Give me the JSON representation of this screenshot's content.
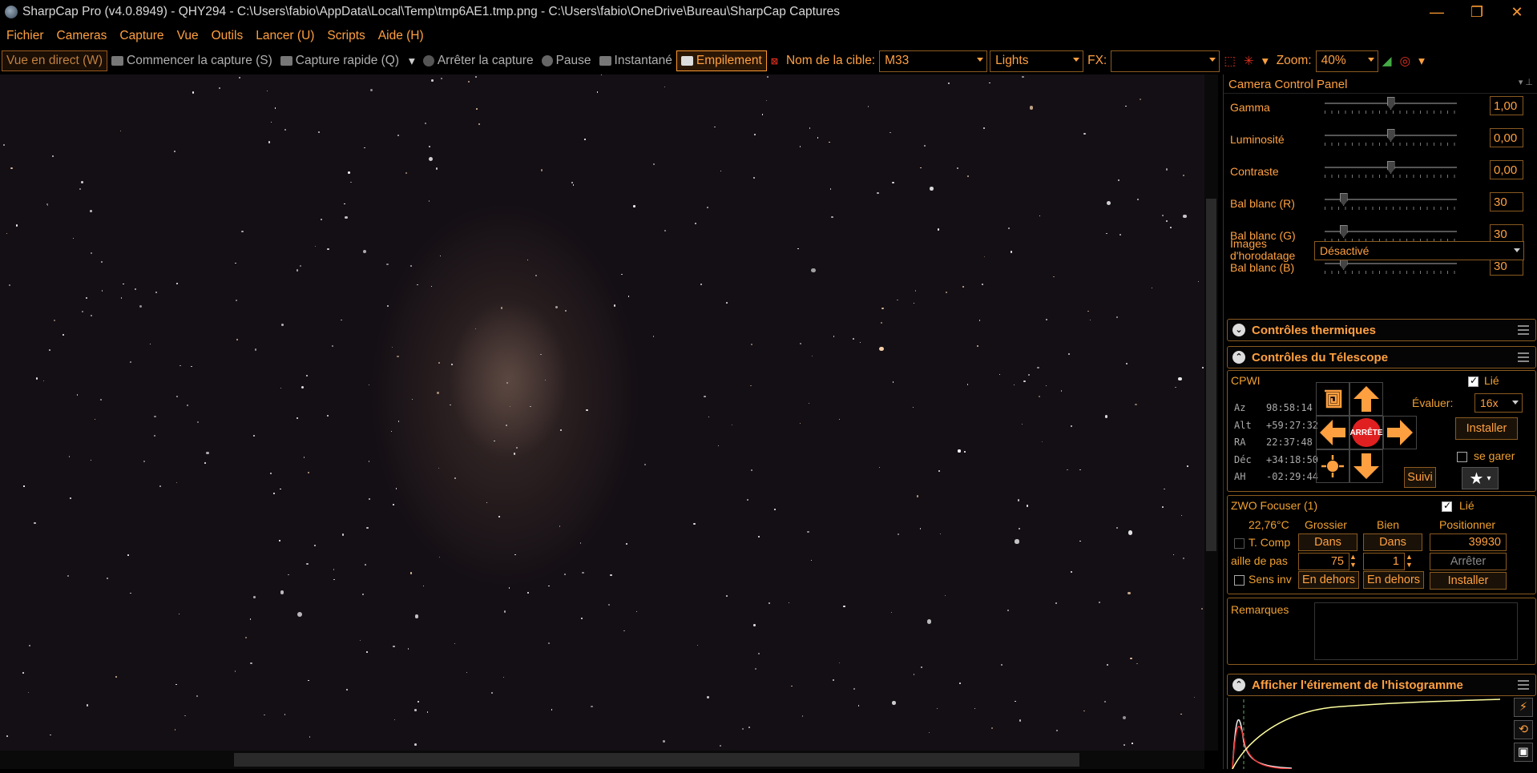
{
  "window": {
    "title": "SharpCap Pro (v4.0.8949) - QHY294 - C:\\Users\\fabio\\AppData\\Local\\Temp\\tmp6AE1.tmp.png - C:\\Users\\fabio\\OneDrive\\Bureau\\SharpCap Captures"
  },
  "menu": [
    "Fichier",
    "Cameras",
    "Capture",
    "Vue",
    "Outils",
    "Lancer (U)",
    "Scripts",
    "Aide (H)"
  ],
  "toolbar": {
    "live": "Vue en direct (W)",
    "start_capture": "Commencer la capture (S)",
    "quick_capture": "Capture rapide (Q)",
    "stop_capture": "Arrêter la capture",
    "pause": "Pause",
    "snapshot": "Instantané",
    "stacking": "Empilement",
    "target_label": "Nom de la cible:",
    "target_value": "M33",
    "frame_type": "Lights",
    "fx_label": "FX:",
    "fx_value": "",
    "zoom_label": "Zoom:",
    "zoom_value": "40%"
  },
  "panel": {
    "title": "Camera Control Panel",
    "controls": [
      {
        "label": "Gamma",
        "value": "1,00",
        "pos": 0.5
      },
      {
        "label": "Luminosité",
        "value": "0,00",
        "pos": 0.5
      },
      {
        "label": "Contraste",
        "value": "0,00",
        "pos": 0.5
      },
      {
        "label": "Bal blanc (R)",
        "value": "30",
        "pos": 0.12
      },
      {
        "label": "Bal blanc (G)",
        "value": "30",
        "pos": 0.12
      },
      {
        "label": "Bal blanc (B)",
        "value": "30",
        "pos": 0.12
      }
    ],
    "timestamp_label": "Images d'horodatage",
    "timestamp_value": "Désactivé",
    "thermal": "Contrôles thermiques",
    "telescope": "Contrôles du Télescope",
    "mount": {
      "name": "CPWI",
      "linked": "Lié",
      "az_l": "Az",
      "az": "98:58:14",
      "alt_l": "Alt",
      "alt": "+59:27:32",
      "ra_l": "RA",
      "ra": "22:37:48",
      "dec_l": "Déc",
      "dec": "+34:18:50",
      "ah_l": "AH",
      "ah": "-02:29:44",
      "stop": "ARRÊTE",
      "rate_label": "Évaluer:",
      "rate": "16x",
      "setup": "Installer",
      "park": "se garer",
      "track": "Suivi"
    },
    "focuser": {
      "name": "ZWO Focuser (1)",
      "linked": "Lié",
      "temp": "22,76°C",
      "coarse": "Grossier",
      "fine": "Bien",
      "position": "Positionner",
      "tcomp": "T. Comp",
      "in1": "Dans",
      "in2": "Dans",
      "pos_value": "39930",
      "step_label": "aille de pas",
      "step_coarse": "75",
      "step_fine": "1",
      "stop": "Arrêter",
      "reverse": "Sens inv",
      "out1": "En dehors",
      "out2": "En dehors",
      "setup": "Installer"
    },
    "notes": "Remarques",
    "histogram": "Afficher l'étirement de l'histogramme"
  },
  "colors": {
    "accent": "#ffa040",
    "stop_red": "#e02020"
  }
}
